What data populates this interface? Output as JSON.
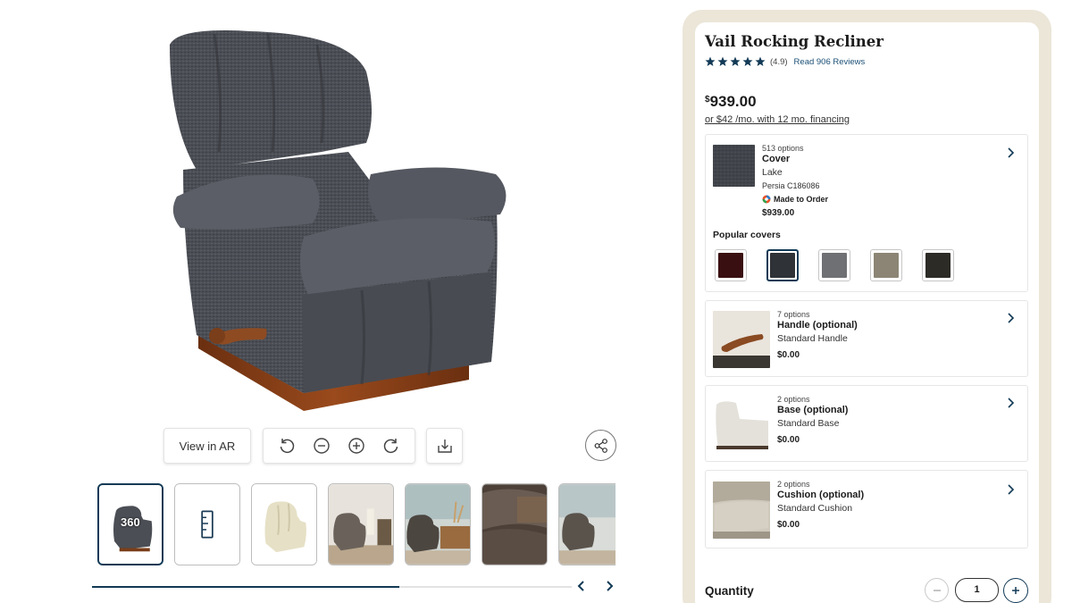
{
  "viewer": {
    "view_ar_label": "View in AR",
    "tools": {
      "rotate_left_icon": "rotate-ccw-icon",
      "zoom_out_icon": "zoom-out-icon",
      "zoom_in_icon": "zoom-in-icon",
      "rotate_right_icon": "rotate-cw-icon",
      "download_icon": "download-icon",
      "share_icon": "share-icon"
    },
    "thumbnails": [
      {
        "label": "360",
        "kind": "360-view"
      },
      {
        "label": "",
        "kind": "dimensions"
      },
      {
        "label": "",
        "kind": "cream-recliner"
      },
      {
        "label": "",
        "kind": "room-scene-1"
      },
      {
        "label": "",
        "kind": "room-scene-2"
      },
      {
        "label": "",
        "kind": "fabric-closeup"
      },
      {
        "label": "",
        "kind": "room-scene-3"
      }
    ],
    "scroll_progress": 0.64
  },
  "product": {
    "title": "Vail Rocking Recliner",
    "rating_score": "(4.9)",
    "rating_value": 4.9,
    "reviews_link": "Read 906 Reviews",
    "price_currency": "$",
    "price_amount": "939.00",
    "financing": "or $42 /mo. with 12 mo. financing"
  },
  "cover": {
    "count": "513 options",
    "name": "Cover",
    "value": "Lake",
    "sub": "Persia C186086",
    "made_to_order": "Made to Order",
    "price": "$939.00",
    "popular_label": "Popular covers",
    "swatch_colors": [
      "#3a0f11",
      "#2f3237",
      "#6f7073",
      "#8c8575",
      "#2d2b26"
    ],
    "selected_swatch": 1
  },
  "options": [
    {
      "count": "7 options",
      "name": "Handle (optional)",
      "value": "Standard Handle",
      "price": "$0.00"
    },
    {
      "count": "2 options",
      "name": "Base (optional)",
      "value": "Standard Base",
      "price": "$0.00"
    },
    {
      "count": "2 options",
      "name": "Cushion (optional)",
      "value": "Standard Cushion",
      "price": "$0.00"
    }
  ],
  "quantity": {
    "label": "Quantity",
    "value": "1"
  },
  "colors": {
    "accent": "#123a56",
    "panel_bg": "#ebe6d8"
  }
}
